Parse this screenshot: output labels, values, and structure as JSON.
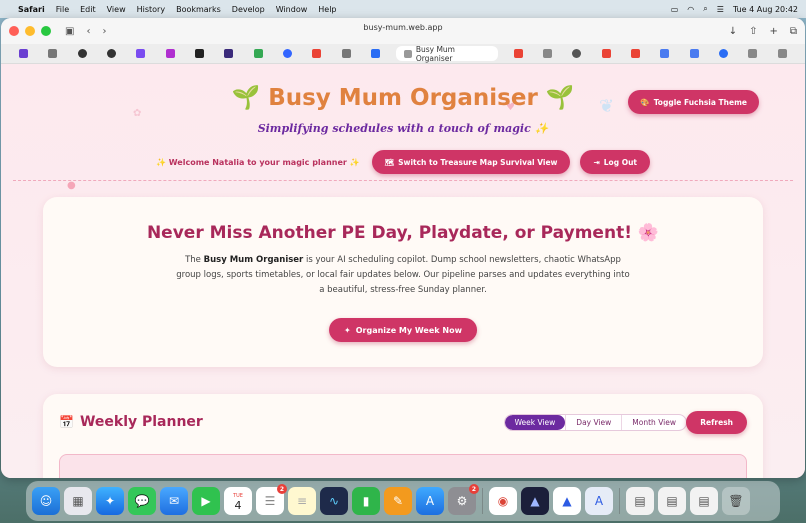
{
  "menubar": {
    "app_name": "Safari",
    "items": [
      "File",
      "Edit",
      "View",
      "History",
      "Bookmarks",
      "Develop",
      "Window",
      "Help"
    ],
    "datetime": "Tue 4 Aug  20:42"
  },
  "browser": {
    "address": "busy-mum.web.app",
    "active_tab": "Busy Mum Organiser"
  },
  "header": {
    "title": "Busy Mum Organiser",
    "subtitle": "Simplifying schedules with a touch of magic ✨",
    "theme_button": "Toggle Fuchsia Theme",
    "welcome": "✨ Welcome Natalia to your magic planner ✨",
    "map_button": "Switch to Treasure Map Survival View",
    "logout_button": "Log Out"
  },
  "hero": {
    "heading": "Never Miss Another PE Day, Playdate, or Payment! 🌸",
    "body_prefix": "The ",
    "body_bold": "Busy Mum Organiser",
    "body_rest": " is your AI scheduling copilot. Dump school newsletters, chaotic WhatsApp group logs, sports timetables, or local fair updates below. Our pipeline parses and updates everything into a beautiful, stress-free Sunday planner.",
    "cta": "Organize My Week Now"
  },
  "planner": {
    "title": "Weekly Planner",
    "views": [
      "Week View",
      "Day View",
      "Month View"
    ],
    "active_view": "Week View",
    "refresh": "Refresh"
  },
  "dock": {
    "calendar_day": "4",
    "calendar_month": "TUE",
    "reminders_badge": "2",
    "settings_badge": "2"
  },
  "colors": {
    "accent": "#cf3566",
    "title_orange": "#e0823f",
    "purple": "#6c2aa0",
    "heading": "#a8285a"
  }
}
